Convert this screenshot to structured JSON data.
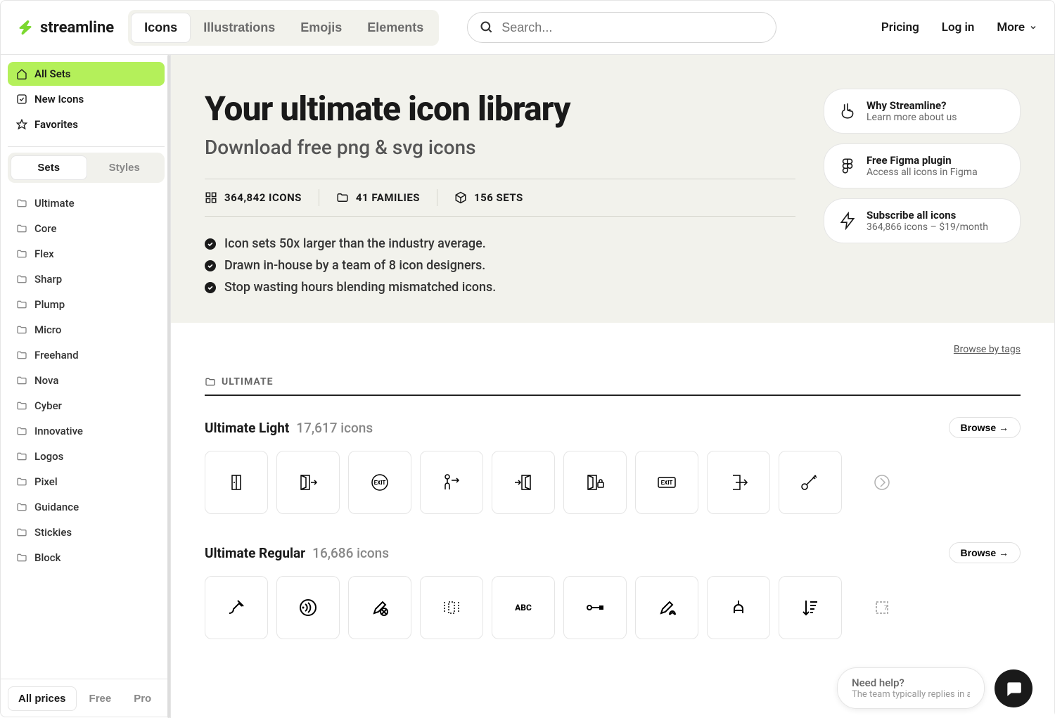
{
  "brand": "streamline",
  "nav": {
    "tabs": [
      "Icons",
      "Illustrations",
      "Emojis",
      "Elements"
    ]
  },
  "search": {
    "placeholder": "Search..."
  },
  "header_links": {
    "pricing": "Pricing",
    "login": "Log in",
    "more": "More"
  },
  "sidebar": {
    "top": [
      {
        "label": "All Sets",
        "icon": "home"
      },
      {
        "label": "New Icons",
        "icon": "checkbox"
      },
      {
        "label": "Favorites",
        "icon": "star"
      }
    ],
    "switch": [
      "Sets",
      "Styles"
    ],
    "folders": [
      "Ultimate",
      "Core",
      "Flex",
      "Sharp",
      "Plump",
      "Micro",
      "Freehand",
      "Nova",
      "Cyber",
      "Innovative",
      "Logos",
      "Pixel",
      "Guidance",
      "Stickies",
      "Block"
    ],
    "prices": [
      "All prices",
      "Free",
      "Pro"
    ]
  },
  "hero": {
    "title": "Your ultimate icon library",
    "subtitle": "Download free png & svg icons",
    "stats": [
      {
        "value": "364,842 ICONS"
      },
      {
        "value": "41 FAMILIES"
      },
      {
        "value": "156 SETS"
      }
    ],
    "bullets": [
      "Icon sets 50x larger than the industry average.",
      "Drawn in-house by a team of 8 icon designers.",
      "Stop wasting hours blending mismatched icons."
    ],
    "promos": [
      {
        "title": "Why Streamline?",
        "sub": "Learn more about us"
      },
      {
        "title": "Free Figma plugin",
        "sub": "Access all icons in Figma"
      },
      {
        "title": "Subscribe all icons",
        "sub": "364,866 icons – $19/month"
      }
    ]
  },
  "content": {
    "browse_tags": "Browse by tags",
    "section_label": "ULTIMATE",
    "sets": [
      {
        "name": "Ultimate Light",
        "count": "17,617 icons",
        "browse": "Browse →"
      },
      {
        "name": "Ultimate Regular",
        "count": "16,686 icons",
        "browse": "Browse →"
      }
    ]
  },
  "chat": {
    "title": "Need help?",
    "sub": "The team typically replies in a"
  }
}
